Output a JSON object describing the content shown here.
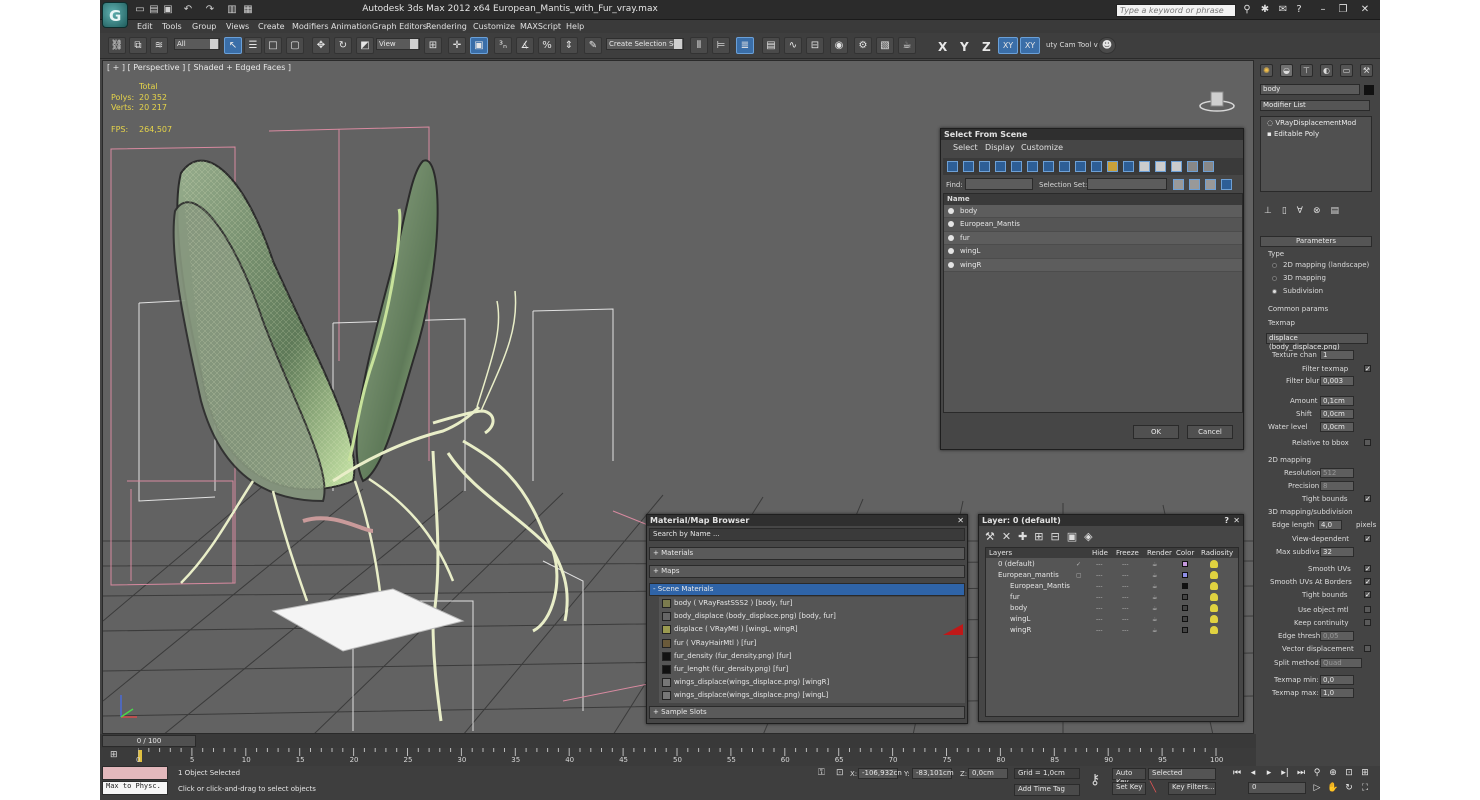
{
  "titlebar": {
    "title": "Autodesk 3ds Max  2012 x64     European_Mantis_with_Fur_vray.max",
    "search_placeholder": "Type a keyword or phrase"
  },
  "menu": [
    "Edit",
    "Tools",
    "Group",
    "Views",
    "Create",
    "Modifiers",
    "Animation",
    "Graph Editors",
    "Rendering",
    "Customize",
    "MAXScript",
    "Help"
  ],
  "toolbar": {
    "filter_value": "All",
    "ref_coord": "View",
    "selection_set_placeholder": "Create Selection Se",
    "axis": [
      "X",
      "Y",
      "Z",
      "XY",
      "XY"
    ],
    "cam_tool": "uty Cam Tool v"
  },
  "viewport": {
    "label": "[ + ] [ Perspective ] [ Shaded + Edged Faces ]",
    "stats": {
      "header": "Total",
      "polys_label": "Polys:",
      "polys": "20 352",
      "verts_label": "Verts:",
      "verts": "20 217",
      "fps_label": "FPS:",
      "fps": "264,507"
    }
  },
  "select_from_scene": {
    "title": "Select From Scene",
    "menu": [
      "Select",
      "Display",
      "Customize"
    ],
    "find_label": "Find:",
    "selection_set_label": "Selection Set:",
    "column": "Name",
    "items": [
      "body",
      "European_Mantis",
      "fur",
      "wingL",
      "wingR"
    ],
    "ok": "OK",
    "cancel": "Cancel"
  },
  "material_browser": {
    "title": "Material/Map Browser",
    "search_placeholder": "Search by Name ...",
    "categories": [
      "+ Materials",
      "+ Maps",
      "- Scene Materials"
    ],
    "scene_materials": [
      "body  ( VRayFastSSS2 )  [body, fur]",
      "body_displace (body_displace.png) [body, fur]",
      "displace  ( VRayMtl )  [wingL, wingR]",
      "fur  ( VRayHairMtl )  [fur]",
      "fur_density (fur_density.png)  [fur]",
      "fur_lenght (fur_density.png)  [fur]",
      "wings_displace(wings_displace.png) [wingR]",
      "wings_displace(wings_displace.png) [wingL]"
    ],
    "sample_slots": "+ Sample Slots"
  },
  "layer_manager": {
    "title": "Layer: 0 (default)",
    "columns": [
      "Layers",
      "Hide",
      "Freeze",
      "Render",
      "Color",
      "Radiosity"
    ],
    "rows": [
      "0 (default)",
      "European_mantis",
      "European_Mantis",
      "fur",
      "body",
      "wingL",
      "wingR"
    ]
  },
  "command_panel": {
    "object_name": "body",
    "modifier_list": "Modifier List",
    "stack": [
      "VRayDisplacementMod",
      "Editable Poly"
    ],
    "parameters_title": "Parameters",
    "type_label": "Type",
    "type_options": [
      "2D mapping (landscape)",
      "3D mapping",
      "Subdivision"
    ],
    "common_params": "Common params",
    "texmap_label": "Texmap",
    "texmap_value": "displace (body_displace.png)",
    "texture_chan_label": "Texture chan",
    "texture_chan": "1",
    "filter_texmap": "Filter texmap",
    "filter_blur_label": "Filter blur",
    "filter_blur": "0,003",
    "amount_label": "Amount",
    "amount": "0,1cm",
    "shift_label": "Shift",
    "shift": "0,0cm",
    "water_level_label": "Water level",
    "water_level": "0,0cm",
    "relative_bbox": "Relative to bbox",
    "mapping2d": "2D mapping",
    "resolution_label": "Resolution",
    "resolution": "512",
    "precision_label": "Precision",
    "precision": "8",
    "tight_bounds": "Tight bounds",
    "mapping3d": "3D mapping/subdivision",
    "edge_length_label": "Edge length",
    "edge_length": "4,0",
    "pixels": "pixels",
    "view_dependent": "View-dependent",
    "max_subdivs_label": "Max subdivs",
    "max_subdivs": "32",
    "smooth_uvs": "Smooth UVs",
    "smooth_uvs_borders": "Smooth UVs At Borders",
    "tight_bounds2": "Tight bounds",
    "use_object_mtl": "Use object mtl",
    "keep_continuity": "Keep continuity",
    "edge_thresh_label": "Edge thresh",
    "edge_thresh": "0,05",
    "vector_displacement": "Vector displacement",
    "split_method_label": "Split method:",
    "split_method": "Quad",
    "texmap_min_label": "Texmap min:",
    "texmap_min": "0,0",
    "texmap_max_label": "Texmap max:",
    "texmap_max": "1,0"
  },
  "timeline": {
    "slider": "0 / 100",
    "ticks": [
      "0",
      "5",
      "10",
      "15",
      "20",
      "25",
      "30",
      "35",
      "40",
      "45",
      "50",
      "55",
      "60",
      "65",
      "70",
      "75",
      "80",
      "85",
      "90",
      "95",
      "100"
    ]
  },
  "status": {
    "maxscript": "Max to Physc.",
    "selected": "1 Object Selected",
    "prompt": "Click or click-and-drag to select objects",
    "x_label": "X:",
    "x": "-106,932cn",
    "y_label": "Y:",
    "y": "-83,101cm",
    "z_label": "Z:",
    "z": "0,0cm",
    "grid": "Grid = 1,0cm",
    "add_time_tag": "Add Time Tag",
    "auto_key": "Auto Key",
    "set_key": "Set Key",
    "selected_dd": "Selected",
    "key_filters": "Key Filters...",
    "frame": "0"
  }
}
